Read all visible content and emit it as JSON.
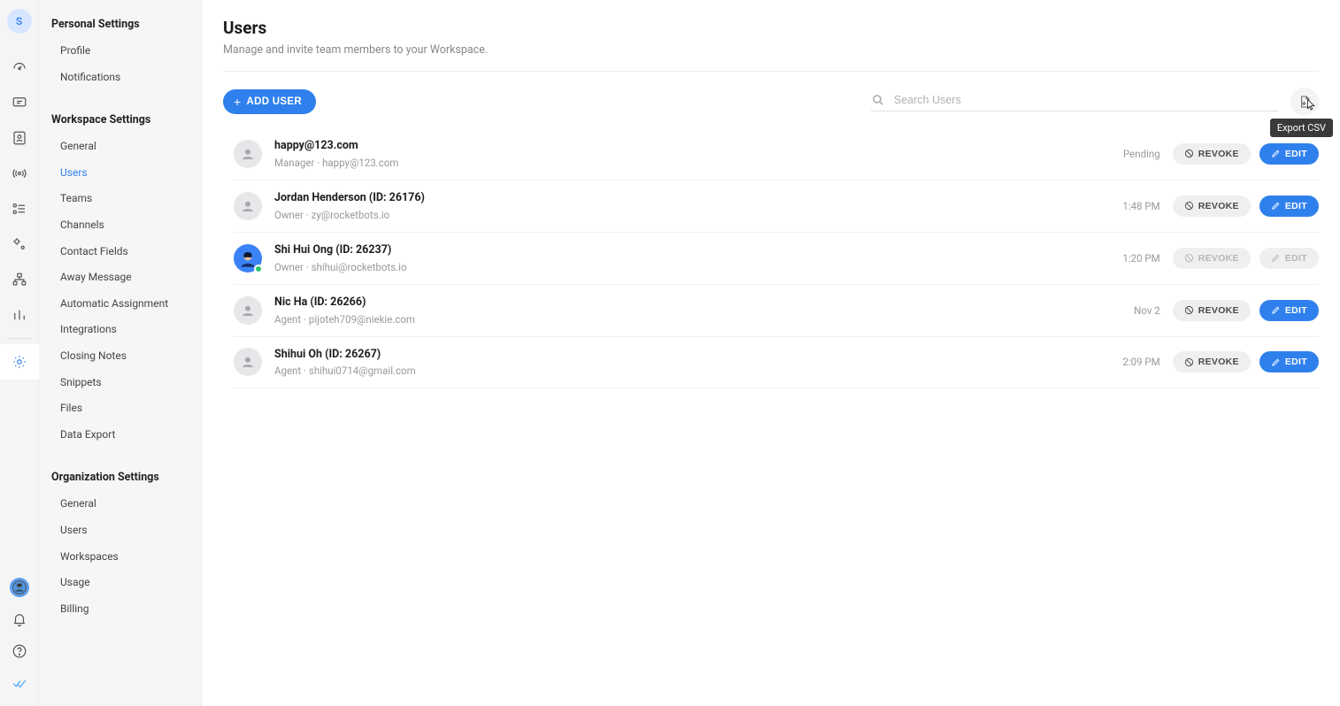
{
  "rail": {
    "avatar_letter": "S"
  },
  "sidebar": {
    "sections": [
      {
        "title": "Personal Settings",
        "items": [
          {
            "label": "Profile"
          },
          {
            "label": "Notifications"
          }
        ]
      },
      {
        "title": "Workspace Settings",
        "items": [
          {
            "label": "General"
          },
          {
            "label": "Users"
          },
          {
            "label": "Teams"
          },
          {
            "label": "Channels"
          },
          {
            "label": "Contact Fields"
          },
          {
            "label": "Away Message"
          },
          {
            "label": "Automatic Assignment"
          },
          {
            "label": "Integrations"
          },
          {
            "label": "Closing Notes"
          },
          {
            "label": "Snippets"
          },
          {
            "label": "Files"
          },
          {
            "label": "Data Export"
          }
        ]
      },
      {
        "title": "Organization Settings",
        "items": [
          {
            "label": "General"
          },
          {
            "label": "Users"
          },
          {
            "label": "Workspaces"
          },
          {
            "label": "Usage"
          },
          {
            "label": "Billing"
          }
        ]
      }
    ]
  },
  "page": {
    "title": "Users",
    "subtitle": "Manage and invite team members to your Workspace."
  },
  "toolbar": {
    "add_user_label": "ADD USER",
    "search_placeholder": "Search Users",
    "export_tooltip": "Export CSV"
  },
  "buttons": {
    "revoke": "REVOKE",
    "edit": "EDIT"
  },
  "users": [
    {
      "name": "happy@123.com",
      "meta": "Manager · happy@123.com",
      "time": "Pending",
      "avatar": "default",
      "revoke_enabled": true,
      "edit_enabled": true
    },
    {
      "name": "Jordan Henderson (ID: 26176)",
      "meta": "Owner · zy@rocketbots.io",
      "time": "1:48 PM",
      "avatar": "default",
      "revoke_enabled": true,
      "edit_enabled": true
    },
    {
      "name": "Shi Hui Ong (ID: 26237)",
      "meta": "Owner · shihui@rocketbots.io",
      "time": "1:20 PM",
      "avatar": "online",
      "revoke_enabled": false,
      "edit_enabled": false
    },
    {
      "name": "Nic Ha (ID: 26266)",
      "meta": "Agent · pijoteh709@niekie.com",
      "time": "Nov 2",
      "avatar": "default",
      "revoke_enabled": true,
      "edit_enabled": true
    },
    {
      "name": "Shihui Oh (ID: 26267)",
      "meta": "Agent · shihui0714@gmail.com",
      "time": "2:09 PM",
      "avatar": "default",
      "revoke_enabled": true,
      "edit_enabled": true
    }
  ]
}
